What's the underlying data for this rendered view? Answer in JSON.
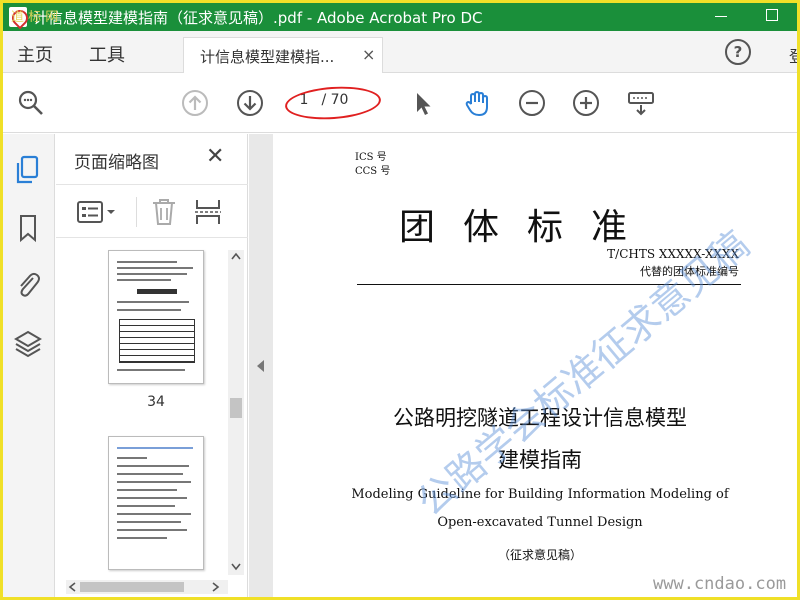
{
  "window": {
    "title": "计信息模型建模指南（征求意见稿）.pdf - Adobe Acrobat Pro DC",
    "watermark_logo": "道 标 网"
  },
  "menu": {
    "home": "主页",
    "tools": "工具",
    "doc_tab": "计信息模型建模指...",
    "close_tab": "×",
    "help": "?",
    "signin": "登"
  },
  "toolbar": {
    "current_page": "1",
    "total_pages": "/ 70",
    "accent_color": "#2a7fd6",
    "annotation_color": "#e02020"
  },
  "rail": {
    "icons": [
      "pages-icon",
      "bookmark-icon",
      "attachment-icon",
      "layers-icon"
    ]
  },
  "thumbnails": {
    "title": "页面缩略图",
    "close": "✕",
    "pages": [
      {
        "label": "34"
      },
      {
        "label": ""
      }
    ]
  },
  "document": {
    "ics": "ICS 号",
    "ccs": "CCS 号",
    "big_title": "团体标准",
    "std_number": "T/CHTS XXXXX-XXXX",
    "std_note": "代替的团体标准编号",
    "title_cn_1": "公路明挖隧道工程设计信息模型",
    "title_cn_2": "建模指南",
    "title_en_1": "Modeling Guideline for Building Information Modeling of",
    "title_en_2": "Open-excavated Tunnel Design",
    "draft_note": "（征求意见稿）",
    "watermark_diag": "公路学会标准征求意见稿",
    "watermark_site": "www.cndao.com"
  }
}
